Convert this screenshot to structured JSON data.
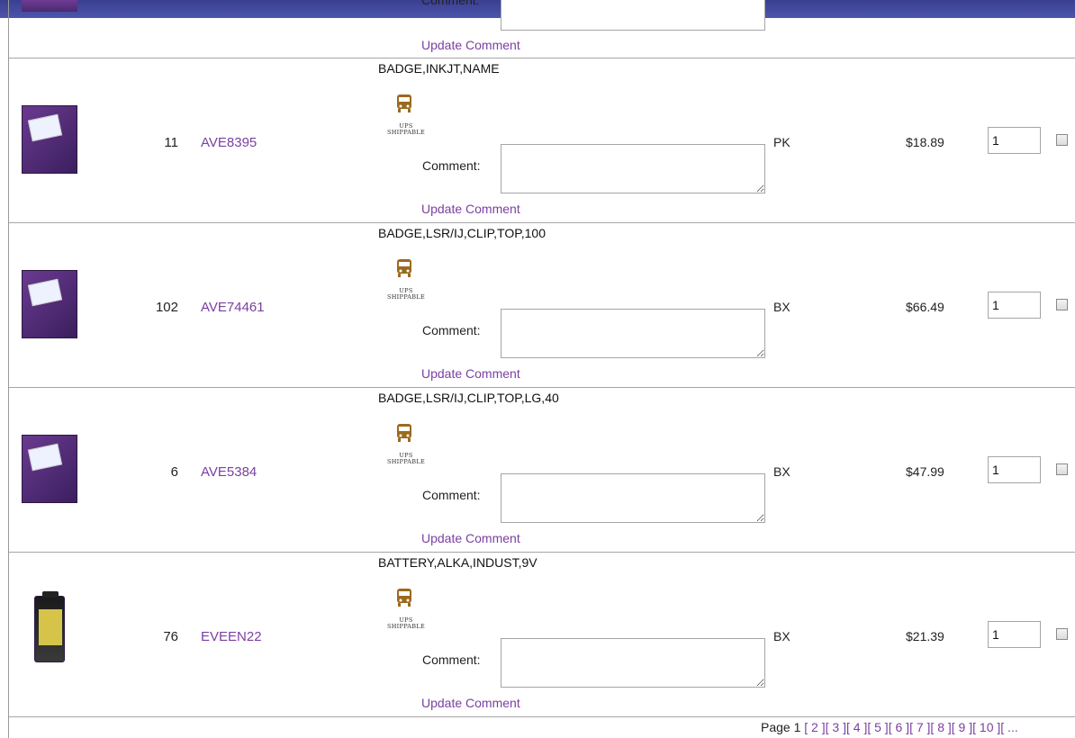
{
  "top_partial": {
    "comment_label": "Comment:",
    "update_label": "Update Comment"
  },
  "products": [
    {
      "qty": "11",
      "sku": "AVE8395",
      "description": "BADGE,INKJT,NAME",
      "ups_line1": "UPS",
      "ups_line2": "SHIPPABLE",
      "comment_label": "Comment:",
      "comment_value": "",
      "update_label": "Update Comment",
      "uom": "PK",
      "price": "$18.89",
      "order_qty": "1",
      "image": "name-badges-box"
    },
    {
      "qty": "102",
      "sku": "AVE74461",
      "description": "BADGE,LSR/IJ,CLIP,TOP,100",
      "ups_line1": "UPS",
      "ups_line2": "SHIPPABLE",
      "comment_label": "Comment:",
      "comment_value": "",
      "update_label": "Update Comment",
      "uom": "BX",
      "price": "$66.49",
      "order_qty": "1",
      "image": "clip-name-badges-box"
    },
    {
      "qty": "6",
      "sku": "AVE5384",
      "description": "BADGE,LSR/IJ,CLIP,TOP,LG,40",
      "ups_line1": "UPS",
      "ups_line2": "SHIPPABLE",
      "comment_label": "Comment:",
      "comment_value": "",
      "update_label": "Update Comment",
      "uom": "BX",
      "price": "$47.99",
      "order_qty": "1",
      "image": "clip-name-badges-box"
    },
    {
      "qty": "76",
      "sku": "EVEEN22",
      "description": "BATTERY,ALKA,INDUST,9V",
      "ups_line1": "UPS",
      "ups_line2": "SHIPPABLE",
      "comment_label": "Comment:",
      "comment_value": "",
      "update_label": "Update Comment",
      "uom": "BX",
      "price": "$21.39",
      "order_qty": "1",
      "image": "9v-battery"
    }
  ],
  "pager": {
    "label": "Page 1",
    "pages": [
      "[ 2 ]",
      "[ 3 ]",
      "[ 4 ]",
      "[ 5 ]",
      "[ 6 ]",
      "[ 7 ]",
      "[ 8 ]",
      "[ 9 ]",
      "[ 10 ]",
      "[ ..."
    ]
  },
  "colors": {
    "link": "#7b3fa1",
    "border": "#a6a6a6",
    "bus_icon": "#9b6a1e"
  }
}
